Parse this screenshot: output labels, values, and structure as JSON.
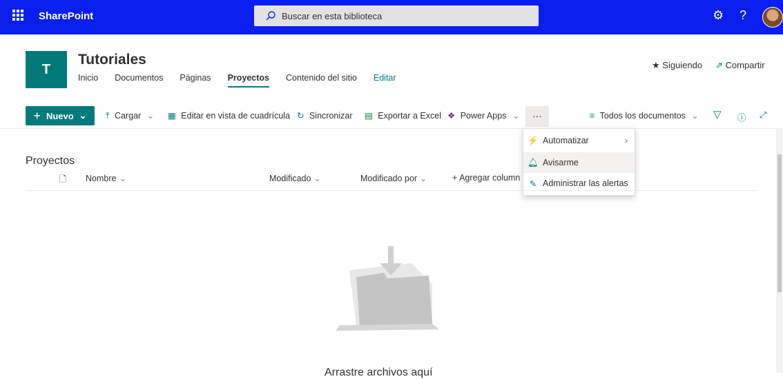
{
  "suite": {
    "brand": "SharePoint",
    "search_placeholder": "Buscar en esta biblioteca"
  },
  "site": {
    "logo_letter": "T",
    "title": "Tutoriales",
    "nav": [
      "Inicio",
      "Documentos",
      "Páginas",
      "Proyectos",
      "Contenido del sitio",
      "Editar"
    ],
    "active_nav": "Proyectos",
    "follow_label": "Siguiendo",
    "share_label": "Compartir"
  },
  "commandbar": {
    "new_label": "Nuevo",
    "upload_label": "Cargar",
    "grid_edit_label": "Editar en vista de cuadrícula",
    "sync_label": "Sincronizar",
    "export_label": "Exportar a Excel",
    "powerapps_label": "Power Apps",
    "more_label": "···",
    "view_label": "Todos los documentos"
  },
  "overflow_menu": {
    "items": [
      {
        "label": "Automatizar",
        "icon": "flow-icon",
        "submenu": true
      },
      {
        "label": "Avisarme",
        "icon": "bell-icon",
        "hover": true
      },
      {
        "label": "Administrar las alertas",
        "icon": "manage-alerts-icon"
      }
    ]
  },
  "library": {
    "title": "Proyectos",
    "columns": [
      "Nombre",
      "Modificado",
      "Modificado por",
      "+ Agregar column"
    ],
    "empty_text": "Arrastre archivos aquí"
  },
  "colors": {
    "suitebar": "#0b1ef0",
    "accent": "#037a7a"
  }
}
